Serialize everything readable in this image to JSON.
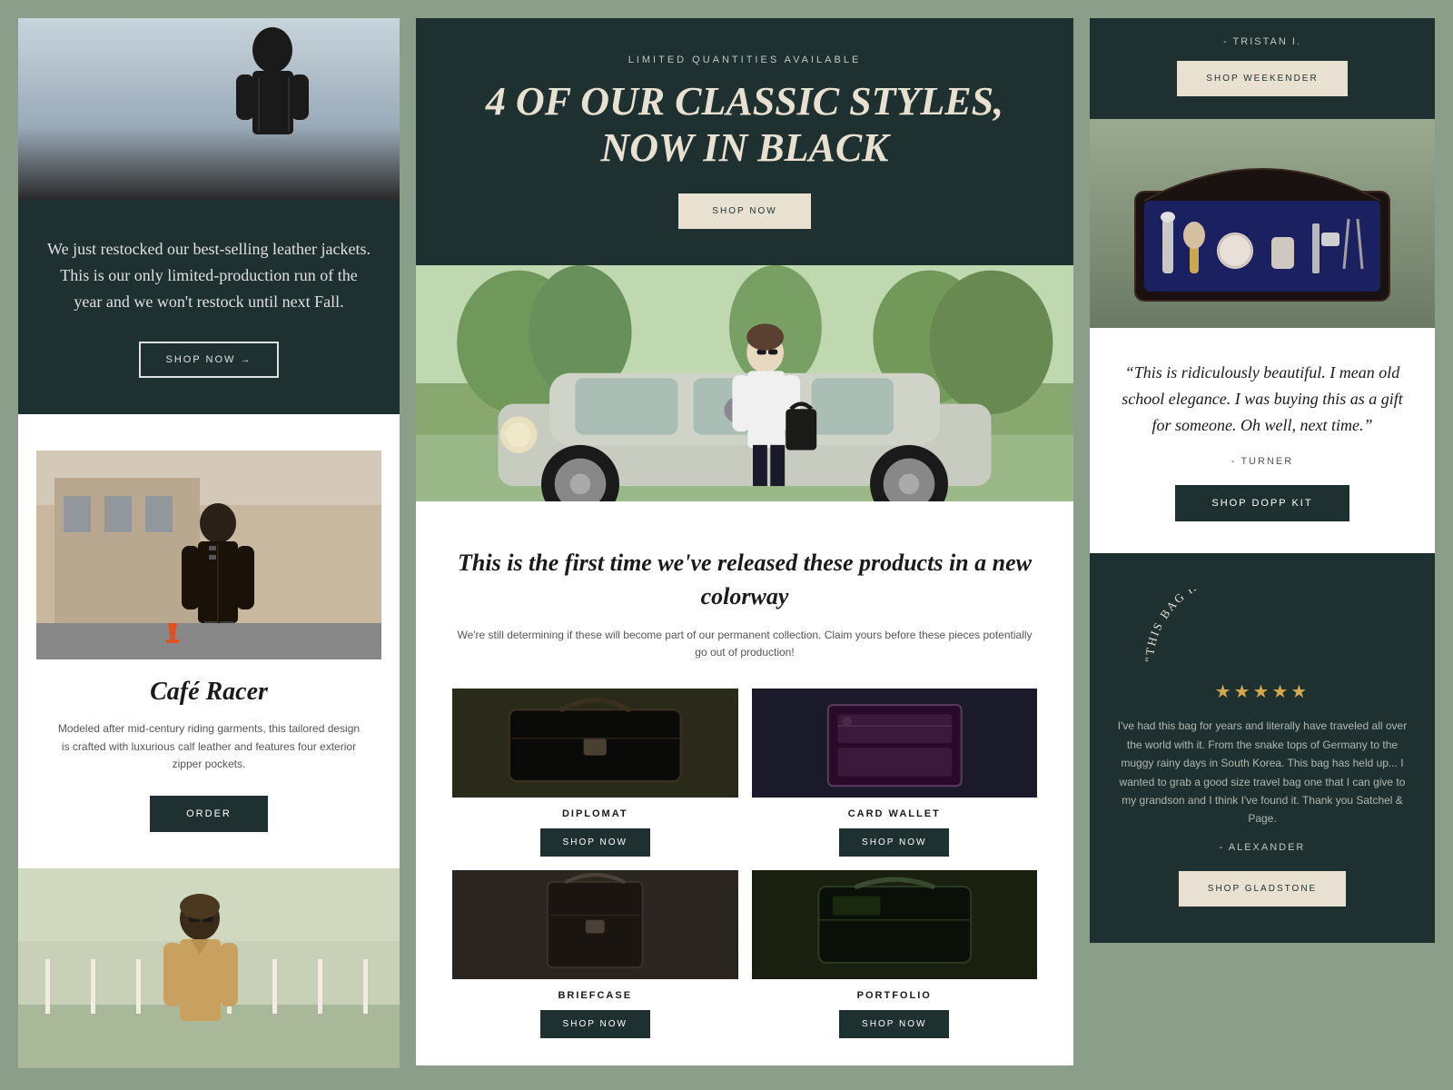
{
  "left_column": {
    "hero_alt": "Person with leather jacket",
    "dark_section": {
      "body_text": "We just restocked our best-selling leather jackets. This is our only limited-production run of the year and we won't restock until next Fall.",
      "cta_label": "SHOP NOW →"
    },
    "cafe_racer": {
      "title": "Café Racer",
      "description": "Modeled after mid-century riding garments, this tailored design is crafted with luxurious calf leather and features four exterior zipper pockets.",
      "cta_label": "ORDER"
    },
    "bottom_img_alt": "Man in leather jacket outdoors"
  },
  "center_column": {
    "top_section": {
      "limited_label": "LIMITED QUANTITIES AVAILABLE",
      "headline": "4 OF OUR CLASSIC STYLES, NOW IN BLACK",
      "cta_label": "SHOP NOW"
    },
    "car_img_alt": "Man with bag leaning on vintage car",
    "products_section": {
      "intro_headline": "This is the first time we've released these products in a new colorway",
      "intro_desc": "We're still determining if these will become part of our permanent collection. Claim yours before these pieces potentially go out of production!",
      "products": [
        {
          "name": "DIPLOMAT",
          "cta_label": "SHOP NOW"
        },
        {
          "name": "CARD WALLET",
          "cta_label": "SHOP NOW"
        },
        {
          "name": "BRIEFCASE",
          "cta_label": "SHOP NOW"
        },
        {
          "name": "PORTFOLIO",
          "cta_label": "SHOP NOW"
        }
      ]
    }
  },
  "right_column": {
    "top_section": {
      "reviewer_name": "- TRISTAN I.",
      "cta_label": "SHOP WEEKENDER"
    },
    "dopp_kit_img_alt": "Dopp kit open with grooming items",
    "review_section": {
      "quote": "“This is ridiculously beautiful. I mean old school elegance. I was buying this as a gift for someone. Oh well, next time.”",
      "reviewer": "- TURNER",
      "cta_label": "SHOP DOPP KIT"
    },
    "bottom_section": {
      "arc_text": "\"THIS BAG HAS HELD UP\"",
      "stars": "★★★★★",
      "review_body": "I've had this bag for years and literally have traveled all over the world with it. From the snake tops of Germany to the muggy rainy days in South Korea. This bag has held up... I wanted to grab a good size travel bag one that I can give to my grandson and I think I've found it. Thank you Satchel & Page.",
      "reviewer": "- ALEXANDER",
      "cta_label": "SHOP GLADSTONE"
    }
  }
}
